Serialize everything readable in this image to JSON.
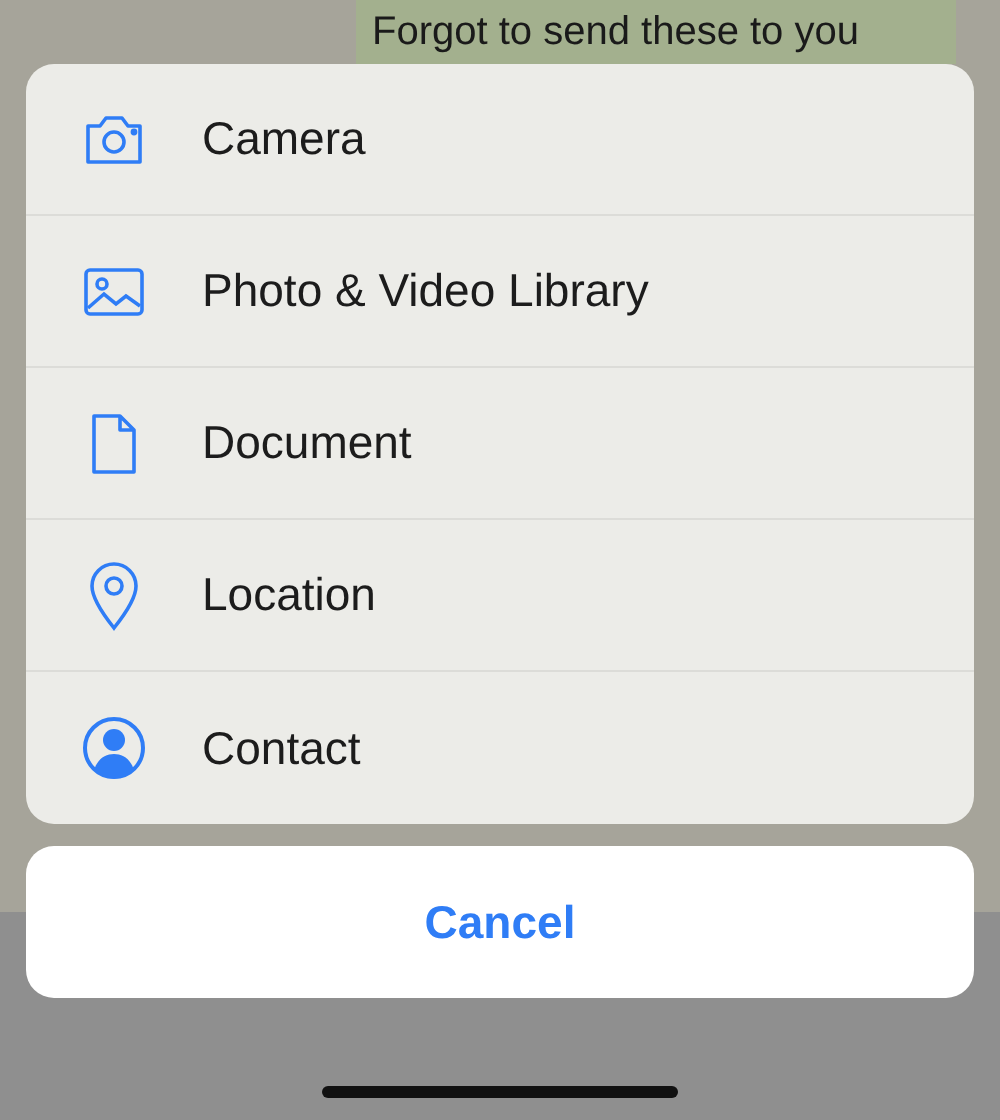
{
  "chat": {
    "bubble_text": "Forgot to send these to you"
  },
  "action_sheet": {
    "items": [
      {
        "kind": "camera",
        "label": "Camera"
      },
      {
        "kind": "photo",
        "label": "Photo & Video Library"
      },
      {
        "kind": "document",
        "label": "Document"
      },
      {
        "kind": "location",
        "label": "Location"
      },
      {
        "kind": "contact",
        "label": "Contact"
      }
    ],
    "cancel": "Cancel"
  }
}
